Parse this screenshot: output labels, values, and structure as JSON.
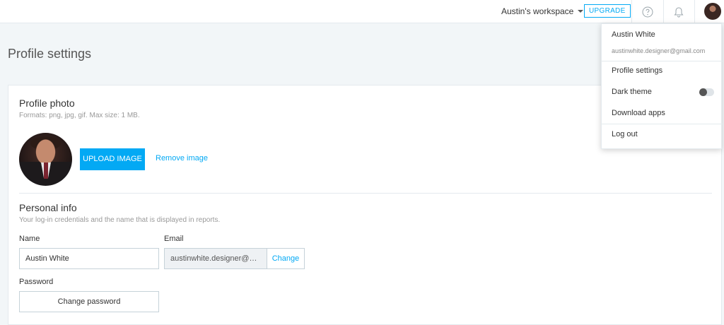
{
  "header": {
    "workspace_label": "Austin's workspace",
    "upgrade_label": "UPGRADE"
  },
  "page": {
    "title": "Profile settings"
  },
  "profile_photo": {
    "title": "Profile photo",
    "description": "Formats: png, jpg, gif. Max size: 1 MB.",
    "upload_label": "UPLOAD IMAGE",
    "remove_label": "Remove image"
  },
  "personal_info": {
    "title": "Personal info",
    "description": "Your log-in credentials and the name that is displayed in reports.",
    "name_label": "Name",
    "name_value": "Austin White",
    "email_label": "Email",
    "email_value": "austinwhite.designer@gmail.com",
    "change_label": "Change",
    "password_label": "Password",
    "change_password_label": "Change password"
  },
  "dropdown": {
    "user_name": "Austin White",
    "user_email": "austinwhite.designer@gmail.com",
    "items": [
      {
        "label": "Profile settings"
      },
      {
        "label": "Dark theme",
        "toggle": false
      },
      {
        "label": "Download apps"
      },
      {
        "label": "Log out"
      }
    ]
  },
  "colors": {
    "accent": "#03a9f4",
    "background": "#f2f6f8"
  },
  "icons": [
    "chevron-down-icon",
    "help-icon",
    "bell-icon",
    "avatar"
  ]
}
